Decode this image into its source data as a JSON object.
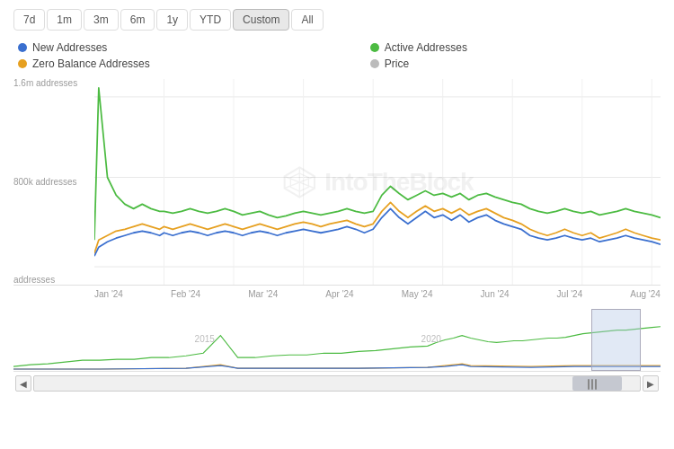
{
  "timeFilters": {
    "buttons": [
      "7d",
      "1m",
      "3m",
      "6m",
      "1y",
      "YTD",
      "Custom",
      "All"
    ],
    "active": "Custom"
  },
  "legend": {
    "items": [
      {
        "label": "New Addresses",
        "color": "#3a6fcf",
        "id": "new"
      },
      {
        "label": "Active Addresses",
        "color": "#4cbb42",
        "id": "active"
      },
      {
        "label": "Zero Balance Addresses",
        "color": "#e6a020",
        "id": "zero"
      },
      {
        "label": "Price",
        "color": "#bbb",
        "id": "price"
      }
    ]
  },
  "chart": {
    "yLabels": [
      "1.6m addresses",
      "800k addresses",
      "addresses"
    ],
    "xLabels": [
      "Jan '24",
      "Feb '24",
      "Mar '24",
      "Apr '24",
      "May '24",
      "Jun '24",
      "Jul '24",
      "Aug '24"
    ],
    "watermark": "IntoTheBlock"
  },
  "miniChart": {
    "labels": [
      "2015",
      "2020"
    ]
  },
  "nav": {
    "leftArrow": "◀",
    "rightArrow": "▶",
    "scrollLines": 3
  }
}
